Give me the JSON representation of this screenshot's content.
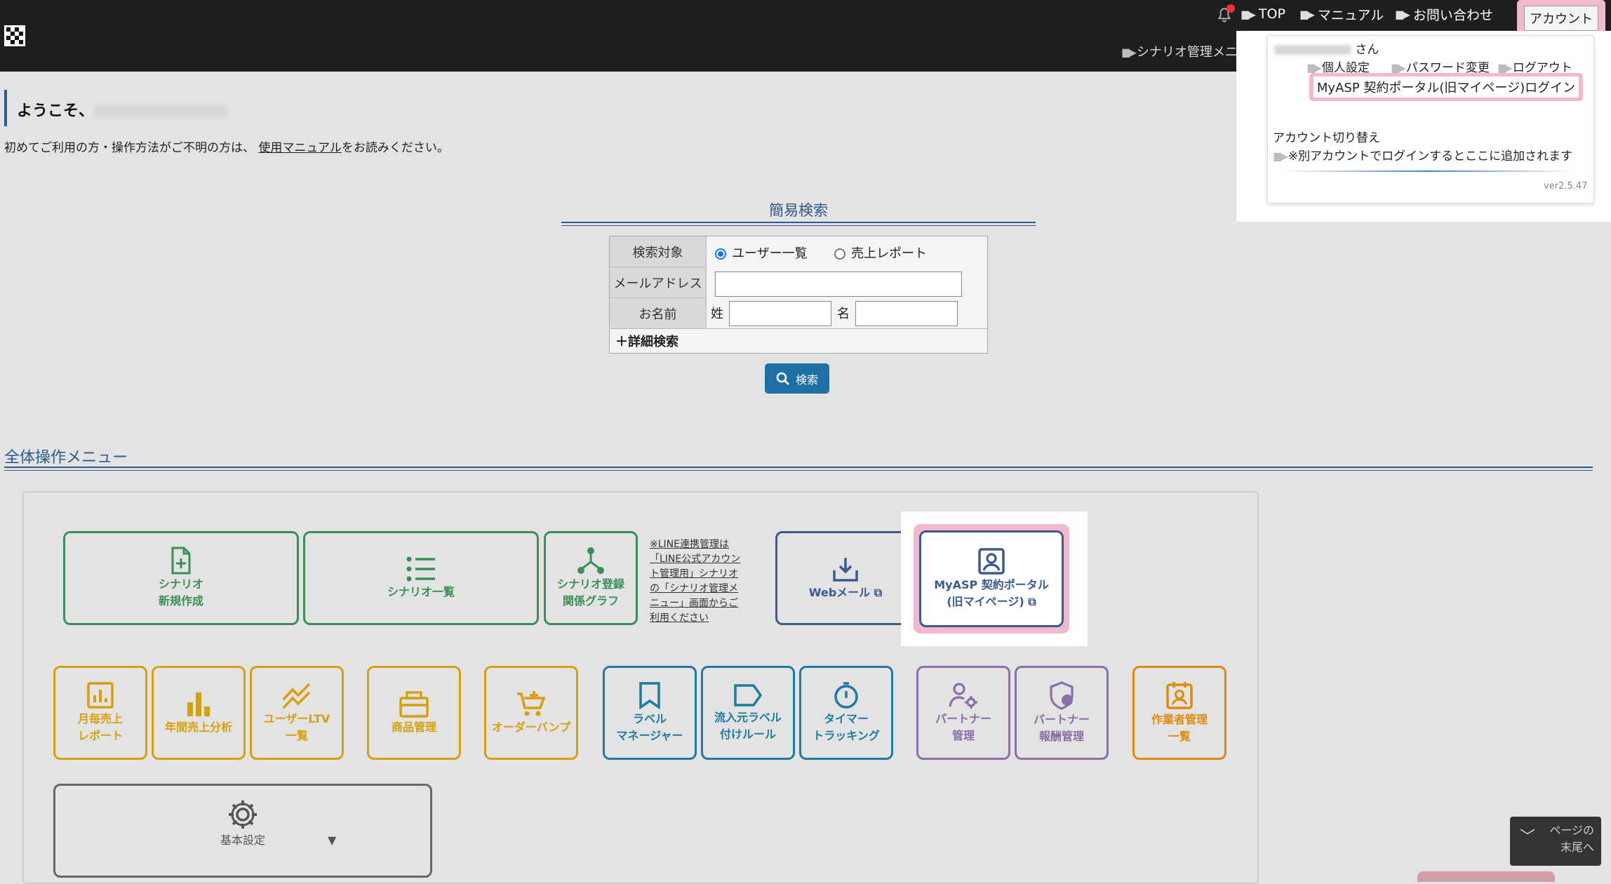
{
  "header": {
    "nav": [
      "TOP",
      "マニュアル",
      "お問い合わせ"
    ],
    "account_label": "アカウント",
    "scenario_menu": "シナリオ管理メニュー"
  },
  "account_menu": {
    "san": "さん",
    "personal_settings": "個人設定",
    "password_change": "パスワード変更",
    "logout": "ログアウト",
    "portal_login": "MyASP 契約ポータル(旧マイページ)ログイン",
    "switch_title": "アカウント切り替え",
    "switch_note": "※別アカウントでログインするとここに追加されます",
    "version": "ver2.5.47"
  },
  "welcome": {
    "prefix": "ようこそ、",
    "intro_before": "初めてご利用の方・操作方法がご不明の方は、",
    "intro_link": "使用マニュアル",
    "intro_after": "をお読みください。"
  },
  "search": {
    "title": "簡易検索",
    "target_label": "検索対象",
    "target_options": [
      "ユーザー一覧",
      "売上レポート"
    ],
    "email_label": "メールアドレス",
    "name_label": "お名前",
    "last_name_label": "姓",
    "first_name_label": "名",
    "advanced": "＋詳細検索",
    "button": "検索"
  },
  "menu": {
    "title": "全体操作メニュー",
    "scenario_new": [
      "シナリオ",
      "新規作成"
    ],
    "scenario_list": "シナリオ一覧",
    "scenario_graph": [
      "シナリオ登録",
      "関係グラフ"
    ],
    "line_note": "※LINE連携管理は「LINE公式アカウント管理用」シナリオの「シナリオ管理メニュー」画面からご利用ください",
    "webmail": "Webメール",
    "portal": [
      "MyASP 契約ポータル",
      "(旧マイページ)"
    ],
    "monthly": [
      "月毎売上",
      "レポート"
    ],
    "annual": "年間売上分析",
    "ltv": [
      "ユーザーLTV",
      "一覧"
    ],
    "products": "商品管理",
    "order_bump": "オーダーバンプ",
    "label_manager": [
      "ラベル",
      "マネージャー"
    ],
    "inflow_label": [
      "流入元ラベル",
      "付けルール"
    ],
    "timer": [
      "タイマー",
      "トラッキング"
    ],
    "partner": [
      "パートナー",
      "管理"
    ],
    "partner_reward": [
      "パートナー",
      "報酬管理"
    ],
    "workers": [
      "作業者管理",
      "一覧"
    ],
    "basic_settings": "基本設定"
  },
  "scroll_end": [
    "ページの",
    "末尾へ"
  ]
}
